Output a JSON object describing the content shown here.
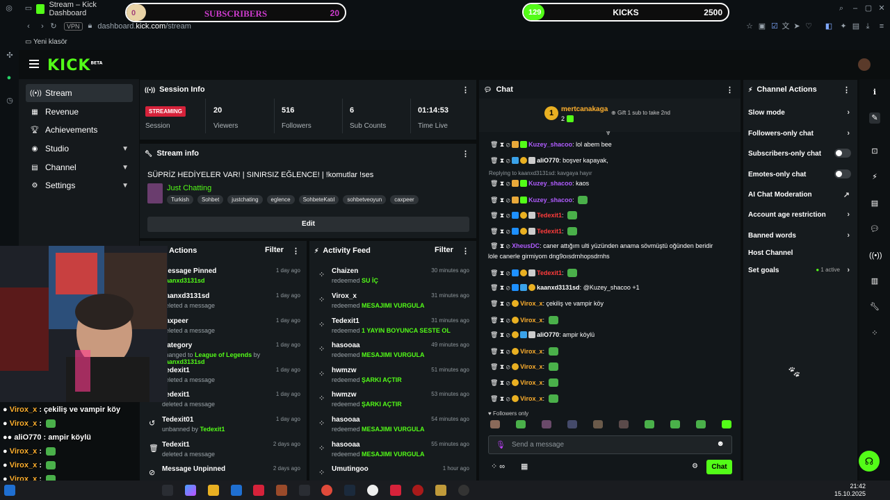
{
  "browser": {
    "tab_title": "Stream – Kick Dashboard",
    "url_host": "dashboard.",
    "url_domain": "kick.com",
    "url_path": "/stream",
    "vpn_label": "VPN",
    "bookmark": "Yeni klasör"
  },
  "overlays": {
    "subscribers": {
      "label": "SUBSCRIBERS",
      "current": "0",
      "goal": "20",
      "progress": 0
    },
    "kicks": {
      "label": "KICKS",
      "current": "129",
      "goal": "2500",
      "progress": 0.05
    }
  },
  "app": {
    "logo": "KICK",
    "logo_tag": "BETA"
  },
  "nav": [
    {
      "label": "Stream",
      "icon": "broadcast-icon",
      "active": true
    },
    {
      "label": "Revenue",
      "icon": "revenue-icon"
    },
    {
      "label": "Achievements",
      "icon": "trophy-icon"
    },
    {
      "label": "Studio",
      "icon": "studio-icon",
      "chevron": true
    },
    {
      "label": "Channel",
      "icon": "channel-icon",
      "chevron": true
    },
    {
      "label": "Settings",
      "icon": "gear-icon",
      "chevron": true
    }
  ],
  "session": {
    "title": "Session Info",
    "badge": "STREAMING",
    "badge_label": "Session",
    "stats": [
      {
        "value": "20",
        "label": "Viewers"
      },
      {
        "value": "516",
        "label": "Followers"
      },
      {
        "value": "6",
        "label": "Sub Counts"
      },
      {
        "value": "01:14:53",
        "label": "Time Live"
      }
    ]
  },
  "stream_info": {
    "title": "Stream info",
    "stream_title": "SÜPRİZ HEDİYELER VAR! | SINIRSIZ EĞLENCE! | !komutlar !ses",
    "category": "Just Chatting",
    "tags": [
      "Turkish",
      "Sohbet",
      "justchating",
      "eglence",
      "SohbeteKatıl",
      "sohbetveoyun",
      "caxpeer"
    ],
    "edit": "Edit"
  },
  "mod_actions": {
    "title": "Actions",
    "filter": "Filter",
    "items": [
      {
        "title": "Message Pinned",
        "sub_user": "kaanxd3131sd",
        "ago": "1 day ago"
      },
      {
        "title": "kaanxd3131sd",
        "sub": "deleted a message",
        "ago": "1 day ago"
      },
      {
        "title": "caxpeer",
        "sub": "deleted a message",
        "ago": "1 day ago"
      },
      {
        "title": "Category",
        "sub_pre": "changed to",
        "sub_hl": "League of Legends",
        "sub_by": "by",
        "sub_user": "kaanxd3131sd",
        "ago": "1 day ago"
      },
      {
        "title": "Tedexit1",
        "sub": "deleted a message",
        "ago": "1 day ago"
      },
      {
        "title": "Tedexit1",
        "sub": "deleted a message",
        "ago": "1 day ago"
      },
      {
        "title": "Tedexit01",
        "sub_pre": "unbanned by",
        "sub_user": "Tedexit1",
        "ago": "1 day ago"
      },
      {
        "title": "Tedexit1",
        "sub": "deleted a message",
        "ago": "2 days ago"
      },
      {
        "title": "Message Unpinned",
        "ago": "2 days ago"
      }
    ]
  },
  "activity": {
    "title": "Activity Feed",
    "filter": "Filter",
    "items": [
      {
        "user": "Chaizen",
        "action": "redeemed",
        "reward": "SU İÇ",
        "ago": "30 minutes ago"
      },
      {
        "user": "Virox_x",
        "action": "redeemed",
        "reward": "MESAJIMI VURGULA",
        "ago": "31 minutes ago"
      },
      {
        "user": "Tedexit1",
        "action": "redeemed",
        "reward": "1 YAYIN BOYUNCA SESTE OL",
        "ago": "31 minutes ago"
      },
      {
        "user": "hasooaa",
        "action": "redeemed",
        "reward": "MESAJIMI VURGULA",
        "ago": "49 minutes ago"
      },
      {
        "user": "hwmzw",
        "action": "redeemed",
        "reward": "ŞARKI AÇTIR",
        "ago": "51 minutes ago"
      },
      {
        "user": "hwmzw",
        "action": "redeemed",
        "reward": "ŞARKI AÇTIR",
        "ago": "53 minutes ago"
      },
      {
        "user": "hasooaa",
        "action": "redeemed",
        "reward": "MESAJIMI VURGULA",
        "ago": "54 minutes ago"
      },
      {
        "user": "hasooaa",
        "action": "redeemed",
        "reward": "MESAJIMI VURGULA",
        "ago": "55 minutes ago"
      },
      {
        "user": "Umutingoo",
        "ago": "1 hour ago"
      }
    ]
  },
  "chat": {
    "title": "Chat",
    "top_gifter": "mertcanakaga",
    "top_gifter_count": "2",
    "gift_prompt": "Gift 1 sub to take 2nd",
    "reply_note": "Replying to kaanxd3131sd: kavgaya hayır",
    "messages": [
      {
        "user": "Kuzey_shacoo",
        "text": "lol abem bee",
        "color": "#b05cff"
      },
      {
        "user": "aliO770",
        "text": "boşver kapayak,",
        "color": "#ffffff"
      },
      {
        "user": "Kuzey_shacoo",
        "text": "kaos",
        "color": "#b05cff"
      },
      {
        "user": "Kuzey_shacoo",
        "text": "",
        "color": "#b05cff",
        "emote": true
      },
      {
        "user": "Tedexit1",
        "text": "",
        "color": "#ff3b3b",
        "emote": true
      },
      {
        "user": "Tedexit1",
        "text": "",
        "color": "#ff3b3b",
        "emote": true
      },
      {
        "user": "XheusDC",
        "text": "caner attığım ulti yüzünden anama sövmüştü oğünden beridir",
        "text2": "lole canerle girmiyom dng9oısdrnhopsdrnhs",
        "color": "#b05cff"
      },
      {
        "user": "Tedexit1",
        "text": "",
        "color": "#ff3b3b",
        "emote": true
      },
      {
        "user": "kaanxd3131sd",
        "text": "@Kuzey_shacoo +1",
        "color": "#ffffff"
      },
      {
        "user": "Virox_x",
        "text": "çekiliş ve vampir köy",
        "color": "#ffb02e"
      },
      {
        "user": "Virox_x",
        "text": "",
        "color": "#ffb02e",
        "emote": true
      },
      {
        "user": "aliO770",
        "text": "ampir köylü",
        "color": "#ffffff"
      },
      {
        "user": "Virox_x",
        "text": "",
        "color": "#ffb02e",
        "emote": true
      },
      {
        "user": "Virox_x",
        "text": "",
        "color": "#ffb02e",
        "emote": true
      },
      {
        "user": "Virox_x",
        "text": "",
        "color": "#ffb02e",
        "emote": true
      },
      {
        "user": "Virox_x",
        "text": "",
        "color": "#ffb02e",
        "emote": true
      }
    ],
    "followers_only": "Followers only",
    "input_placeholder": "Send a message",
    "send": "Chat"
  },
  "channel_actions": {
    "title": "Channel Actions",
    "items": [
      {
        "label": "Slow mode",
        "kind": "arrow"
      },
      {
        "label": "Followers-only chat",
        "kind": "arrow"
      },
      {
        "label": "Subscribers-only chat",
        "kind": "toggle"
      },
      {
        "label": "Emotes-only chat",
        "kind": "toggle"
      },
      {
        "label": "AI Chat Moderation",
        "kind": "external"
      },
      {
        "label": "Account age restriction",
        "kind": "arrow"
      },
      {
        "label": "Banned words",
        "kind": "arrow"
      },
      {
        "label": "Host Channel",
        "kind": "none"
      },
      {
        "label": "Set goals",
        "kind": "arrow",
        "status": "1 active"
      }
    ]
  },
  "stream_overlay_chat": [
    {
      "user": "Virox_x",
      "text": "çekiliş ve vampir köy"
    },
    {
      "user": "Virox_x",
      "text": ""
    },
    {
      "user": "aliO770",
      "text": "ampir köylü"
    },
    {
      "user": "Virox_x",
      "text": ""
    },
    {
      "user": "Virox_x",
      "text": ""
    },
    {
      "user": "Virox_x",
      "text": ""
    }
  ],
  "taskbar": {
    "time": "21:42",
    "date": "15.10.2025"
  },
  "colors": {
    "accent": "#53fc18",
    "live": "#d6223a",
    "panel": "#161b1e",
    "background": "#0b0e0f"
  }
}
